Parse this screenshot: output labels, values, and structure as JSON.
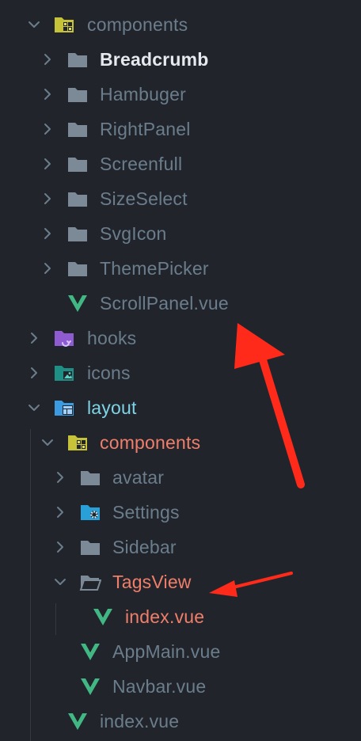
{
  "tree": {
    "components": "components",
    "breadcrumb": "Breadcrumb",
    "hambuger": "Hambuger",
    "rightpanel": "RightPanel",
    "screenfull": "Screenfull",
    "sizeselect": "SizeSelect",
    "svgicon": "SvgIcon",
    "themepicker": "ThemePicker",
    "scrollpanel": "ScrollPanel.vue",
    "hooks": "hooks",
    "icons": "icons",
    "layout": "layout",
    "layout_components": "components",
    "avatar": "avatar",
    "settings": "Settings",
    "sidebar": "Sidebar",
    "tagsview": "TagsView",
    "tagsview_index": "index.vue",
    "appmain": "AppMain.vue",
    "navbar": "Navbar.vue",
    "layout_index": "index.vue"
  },
  "colors": {
    "background": "#21252b",
    "text_muted": "#6b7d8c",
    "text_bright": "#e6eaee",
    "text_highlight": "#f07e6a",
    "vue_green": "#41b883",
    "folder_gray": "#7b8a96",
    "annotation_red": "#ff2a1a"
  },
  "icons": {
    "folder": "folder-icon",
    "open_folder": "folder-open-icon",
    "component_folder": "components-folder-icon",
    "hooks_folder": "hooks-folder-icon",
    "icons_folder": "images-folder-icon",
    "layout_folder": "layout-folder-icon",
    "settings_folder": "settings-folder-icon",
    "vue_file": "vue-file-icon",
    "expanded": "chevron-down-icon",
    "collapsed": "chevron-right-icon"
  }
}
